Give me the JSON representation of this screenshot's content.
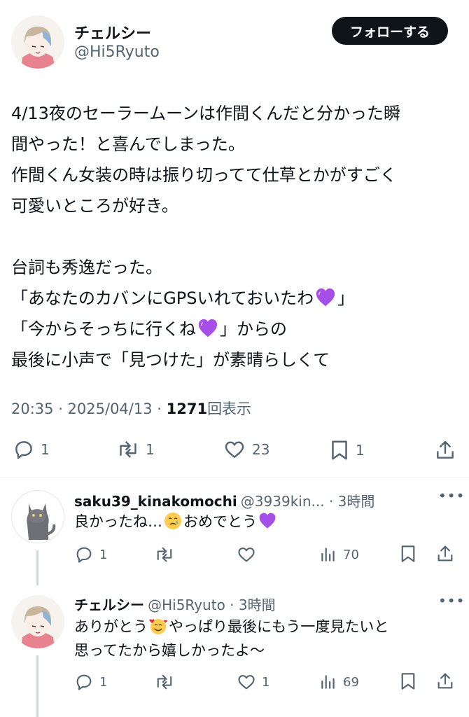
{
  "author": {
    "name": "チェルシー",
    "handle": "@Hi5Ryuto"
  },
  "follow_label": "フォローする",
  "tweet": {
    "lines": [
      "4/13夜のセーラームーンは作間くんだと分かった瞬",
      "間やった！と喜んでしまった。",
      "作間くん女装の時は振り切ってて仕草とかがすごく",
      "可愛いところが好き。",
      "台詞も秀逸だった。",
      "「あなたのカバンにGPSいれておいたわ",
      "」",
      "「今からそっちに行くね",
      "」からの",
      "最後に小声で「見つけた」が素晴らしくて"
    ],
    "time": "20:35 · 2025/04/13 · ",
    "views": "1271",
    "views_label": "回表示"
  },
  "stats": {
    "replies": "1",
    "retweets": "1",
    "likes": "23",
    "bookmarks": "1"
  },
  "replies": [
    {
      "name": "saku39_kinakomochi",
      "handle": "@3939kin... · 3時間",
      "text_before": "良かったね…",
      "text_after": "おめでとう",
      "replies": "1",
      "views": "70"
    },
    {
      "name": "チェルシー",
      "handle": "@Hi5Ryuto · 3時間",
      "line1_before": "ありがとう",
      "line1_after": "やっぱり最後にもう一度見たいと",
      "line2": "思ってたから嬉しかったよ〜",
      "replies": "1",
      "likes": "1",
      "views": "69"
    }
  ],
  "colors": {
    "text": "#0f1419",
    "secondary": "#536471",
    "divider": "#eff3f4",
    "heart_purple": "#a64ee8"
  },
  "icons": [
    "reply-icon",
    "retweet-icon",
    "like-icon",
    "bookmark-icon",
    "share-icon",
    "views-icon",
    "more-icon",
    "purple-heart-emoji",
    "crying-face-emoji",
    "smiling-hearts-emoji"
  ]
}
